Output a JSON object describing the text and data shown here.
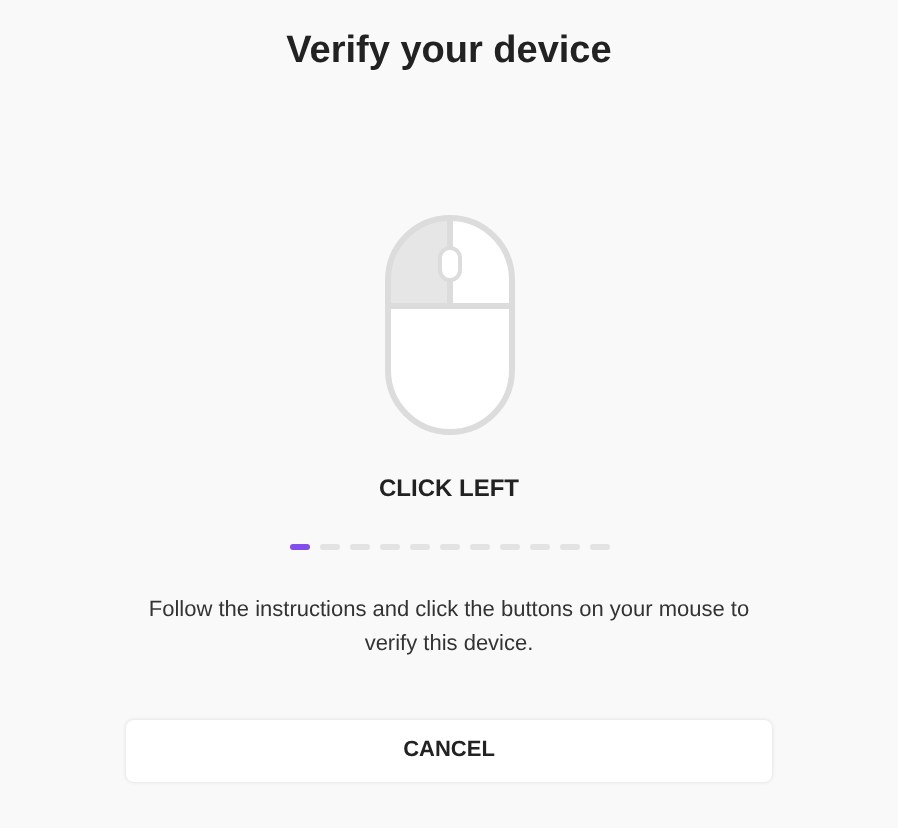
{
  "title": "Verify your device",
  "mouse": {
    "buttons": [
      {
        "highlighted": true
      },
      {
        "highlighted": false
      }
    ]
  },
  "instruction": "CLICK LEFT",
  "steps": [
    {
      "selected": true
    },
    {
      "selected": false
    },
    {
      "selected": false
    },
    {
      "selected": false
    },
    {
      "selected": false
    },
    {
      "selected": false
    },
    {
      "selected": false
    },
    {
      "selected": false
    },
    {
      "selected": false
    },
    {
      "selected": false
    },
    {
      "selected": false
    }
  ],
  "description": "Follow the instructions and click the buttons on your mouse to verify this device.",
  "buttons": [
    "CANCEL"
  ]
}
